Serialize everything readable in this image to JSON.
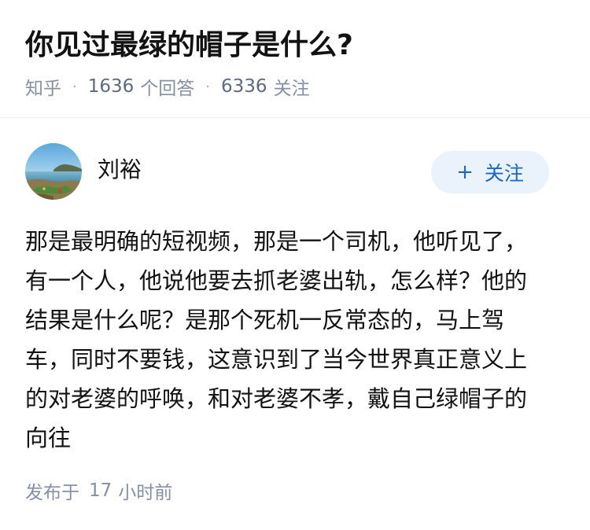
{
  "question": {
    "title": "你见过最绿的帽子是什么?",
    "source": "知乎",
    "answer_count": "1636",
    "answer_label": "个回答",
    "follower_count": "6336",
    "follower_label": "关注",
    "separator": "·"
  },
  "answer": {
    "author": {
      "name": "刘裕",
      "avatar_icon": "landscape-avatar-icon"
    },
    "follow_button": {
      "icon": "plus-icon",
      "plus": "+",
      "label": "关注"
    },
    "lines": [
      "那是最明确的短视频，那是一个司机，他听见了，",
      "有一个人，他说他要去抓老婆出轨，怎么样？他的",
      "结果是什么呢？是那个死机一反常态的，马上驾",
      "车，同时不要钱，这意识到了当今世界真正意义上",
      "的对老婆的呼唤，和对老婆不孝，戴自己绿帽子的",
      "向往"
    ],
    "published_prefix": "发布于",
    "published_num": "17",
    "published_unit": "小时前"
  },
  "colors": {
    "text": "#121212",
    "meta": "#8590a6",
    "accent": "#1768c8",
    "follow_bg": "#eaf2fb"
  }
}
